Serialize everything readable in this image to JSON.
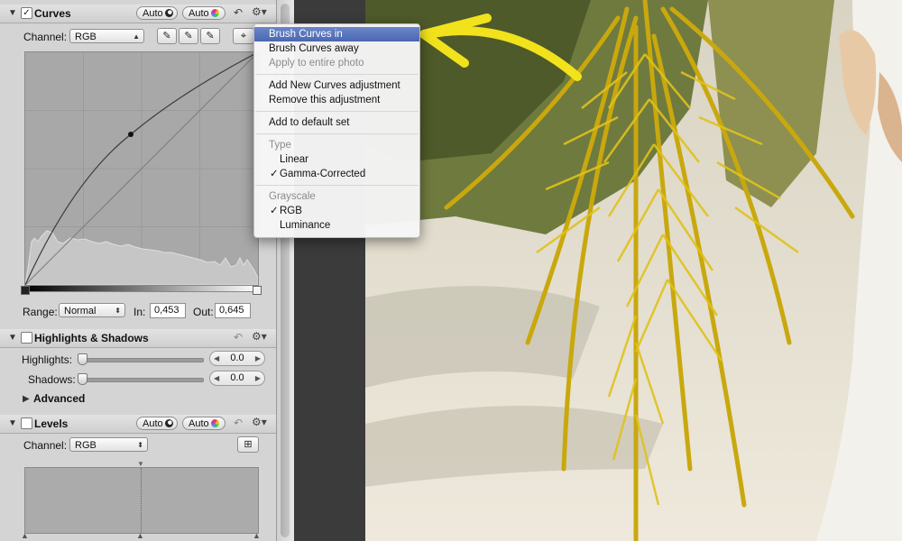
{
  "curves": {
    "title": "Curves",
    "auto1": "Auto",
    "auto2": "Auto",
    "channel_label": "Channel:",
    "channel_value": "RGB",
    "range_label": "Range:",
    "range_value": "Normal",
    "in_label": "In:",
    "in_value": "0,453",
    "out_label": "Out:",
    "out_value": "0,645",
    "enabled": true
  },
  "highlights_shadows": {
    "title": "Highlights & Shadows",
    "highlights_label": "Highlights:",
    "highlights_value": "0.0",
    "shadows_label": "Shadows:",
    "shadows_value": "0.0",
    "advanced_label": "Advanced",
    "enabled": false
  },
  "levels": {
    "title": "Levels",
    "auto1": "Auto",
    "auto2": "Auto",
    "channel_label": "Channel:",
    "channel_value": "RGB",
    "enabled": false
  },
  "menu": {
    "brush_in": "Brush Curves in",
    "brush_away": "Brush Curves away",
    "apply_entire": "Apply to entire photo",
    "add_new": "Add New Curves adjustment",
    "remove": "Remove this adjustment",
    "add_default": "Add to default set",
    "type_header": "Type",
    "linear": "Linear",
    "gamma": "Gamma-Corrected",
    "grayscale_header": "Grayscale",
    "rgb": "RGB",
    "luminance": "Luminance",
    "checkmark": "✓"
  },
  "colors": {
    "highlight": "#4a67b2",
    "arrow": "#f2e21c"
  }
}
